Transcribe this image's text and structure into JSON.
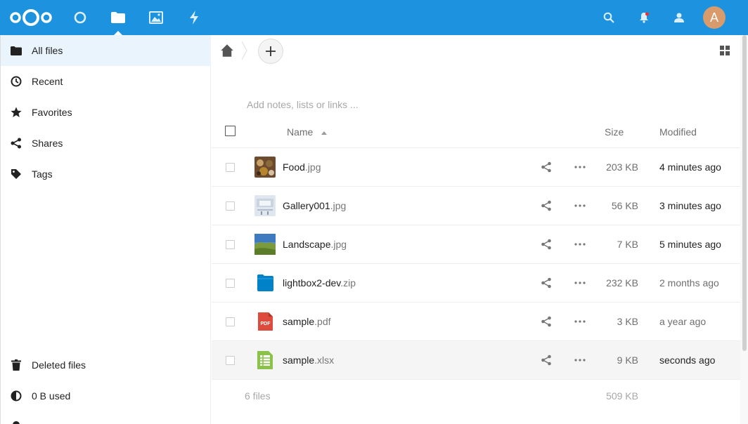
{
  "header": {
    "apps": [
      {
        "name": "dashboard",
        "icon": "circle-icon"
      },
      {
        "name": "files",
        "icon": "folder-icon",
        "active": true
      },
      {
        "name": "photos",
        "icon": "image-icon"
      },
      {
        "name": "activity",
        "icon": "lightning-icon"
      }
    ],
    "avatar_initial": "A",
    "colors": {
      "bar": "#1d93e0"
    }
  },
  "sidebar": {
    "items": [
      {
        "label": "All files",
        "icon": "folder-icon",
        "active": true
      },
      {
        "label": "Recent",
        "icon": "clock-icon"
      },
      {
        "label": "Favorites",
        "icon": "star-icon"
      },
      {
        "label": "Shares",
        "icon": "share-icon"
      },
      {
        "label": "Tags",
        "icon": "tag-icon"
      }
    ],
    "bottom": [
      {
        "label": "Deleted files",
        "icon": "trash-icon"
      },
      {
        "label": "0 B used",
        "icon": "pie-icon"
      }
    ]
  },
  "main": {
    "notes_placeholder": "Add notes, lists or links ...",
    "columns": {
      "name": "Name",
      "size": "Size",
      "modified": "Modified"
    },
    "files": [
      {
        "base": "Food",
        "ext": ".jpg",
        "size": "203 KB",
        "modified": "4 minutes ago",
        "type": "food"
      },
      {
        "base": "Gallery001",
        "ext": ".jpg",
        "size": "56 KB",
        "modified": "3 minutes ago",
        "type": "gallery"
      },
      {
        "base": "Landscape",
        "ext": ".jpg",
        "size": "7 KB",
        "modified": "5 minutes ago",
        "type": "landscape"
      },
      {
        "base": "lightbox2-dev",
        "ext": ".zip",
        "size": "232 KB",
        "modified": "2 months ago",
        "type": "zip"
      },
      {
        "base": "sample",
        "ext": ".pdf",
        "size": "3 KB",
        "modified": "a year ago",
        "type": "pdf"
      },
      {
        "base": "sample",
        "ext": ".xlsx",
        "size": "9 KB",
        "modified": "seconds ago",
        "type": "xlsx"
      }
    ],
    "footer": {
      "count": "6 files",
      "total": "509 KB"
    }
  }
}
